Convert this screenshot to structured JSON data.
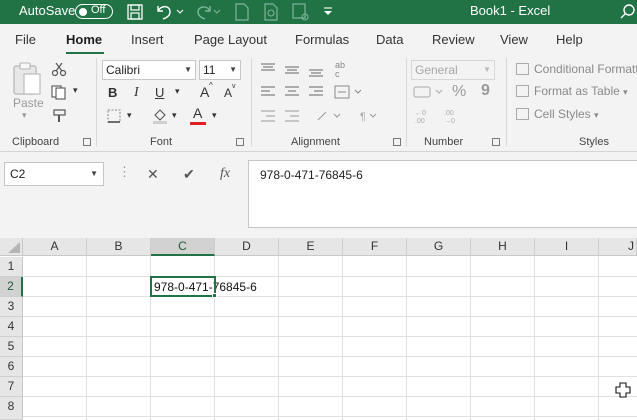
{
  "titlebar": {
    "autosave_label": "AutoSave",
    "autosave_state": "Off",
    "document_title": "Book1  -  Excel",
    "bg_color": "#217346"
  },
  "tabs": [
    "File",
    "Home",
    "Insert",
    "Page Layout",
    "Formulas",
    "Data",
    "Review",
    "View",
    "Help"
  ],
  "active_tab": "Home",
  "ribbon": {
    "clipboard": {
      "paste_label": "Paste",
      "group_label": "Clipboard"
    },
    "font": {
      "font_name": "Calibri",
      "font_size": "11",
      "bold": "B",
      "italic": "I",
      "underline": "U",
      "grow": "A",
      "shrink": "A",
      "font_color_letter": "A",
      "group_label": "Font"
    },
    "alignment": {
      "group_label": "Alignment"
    },
    "number": {
      "format": "General",
      "percent": "%",
      "comma": "9",
      "group_label": "Number"
    },
    "styles": {
      "conditional": "Conditional Formatting",
      "format_table": "Format as Table",
      "cell_styles": "Cell Styles",
      "group_label": "Styles"
    }
  },
  "formula_bar": {
    "name_box": "C2",
    "cancel": "✕",
    "enter": "✔",
    "fx": "fx",
    "value": "978-0-471-76845-6"
  },
  "sheet": {
    "columns": [
      "A",
      "B",
      "C",
      "D",
      "E",
      "F",
      "G",
      "H",
      "I",
      "J"
    ],
    "rows": [
      "1",
      "2",
      "3",
      "4",
      "5",
      "6",
      "7",
      "8"
    ],
    "selected_column": "C",
    "selected_row": "2",
    "cell_c2": "978-0-471-76845-6",
    "accent": "#217346"
  }
}
